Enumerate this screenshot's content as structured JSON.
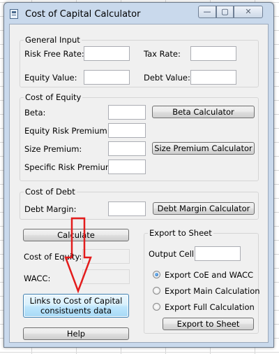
{
  "window": {
    "title": "Cost of Capital Calculator",
    "min_glyph": "—",
    "max_glyph": "▢",
    "close_glyph": "✕"
  },
  "general_input": {
    "title": "General Input",
    "risk_free_rate_label": "Risk Free Rate:",
    "tax_rate_label": "Tax Rate:",
    "equity_value_label": "Equity Value:",
    "debt_value_label": "Debt Value:",
    "risk_free_rate_value": "",
    "tax_rate_value": "",
    "equity_value_value": "",
    "debt_value_value": ""
  },
  "cost_of_equity": {
    "title": "Cost of Equity",
    "beta_label": "Beta:",
    "erp_label": "Equity Risk Premium:",
    "size_premium_label": "Size Premium:",
    "specific_risk_label": "Specific Risk Premium:",
    "beta_value": "",
    "erp_value": "",
    "size_premium_value": "",
    "specific_risk_value": "",
    "beta_calc_button": "Beta Calculator",
    "size_calc_button": "Size Premium Calculator"
  },
  "cost_of_debt": {
    "title": "Cost of Debt",
    "debt_margin_label": "Debt Margin:",
    "debt_margin_value": "",
    "debt_margin_button": "Debt Margin Calculator"
  },
  "results": {
    "calculate_button": "Calculate",
    "coe_label": "Cost of Equity:",
    "wacc_label": "WACC:",
    "coe_value": "",
    "wacc_value": "",
    "links_button_line1": "Links to Cost of Capital",
    "links_button_line2": "consistuents data",
    "help_button": "Help"
  },
  "export": {
    "title": "Export to Sheet",
    "output_cell_label": "Output Cell:",
    "output_cell_value": "",
    "options": [
      {
        "label": "Export CoE and WACC",
        "checked": true
      },
      {
        "label": "Export Main Calculation",
        "checked": false
      },
      {
        "label": "Export Full Calculation",
        "checked": false
      }
    ],
    "export_button": "Export to Sheet"
  },
  "annotation": {
    "arrow_color": "#e31c1c"
  }
}
